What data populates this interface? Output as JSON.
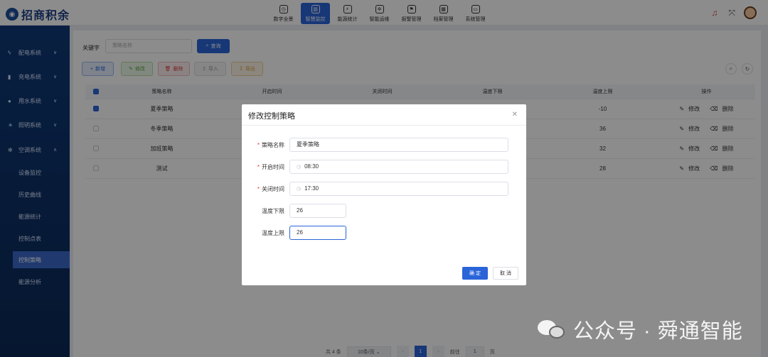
{
  "header": {
    "logo_text": "招商积余",
    "nav": [
      {
        "label": "数字全景",
        "icon": "dashboard-icon"
      },
      {
        "label": "智慧监控",
        "icon": "bar-chart-icon",
        "active": true
      },
      {
        "label": "能源统计",
        "icon": "energy-icon"
      },
      {
        "label": "智能运维",
        "icon": "gear-icon"
      },
      {
        "label": "报警管理",
        "icon": "alarm-icon"
      },
      {
        "label": "档案管理",
        "icon": "archive-icon"
      },
      {
        "label": "系统管理",
        "icon": "monitor-icon"
      }
    ]
  },
  "sidebar": {
    "groups": [
      {
        "label": "配电系统",
        "icon": "lightning-icon"
      },
      {
        "label": "充电系统",
        "icon": "charger-icon"
      },
      {
        "label": "用水系统",
        "icon": "water-drop-icon"
      },
      {
        "label": "照明系统",
        "icon": "light-icon"
      },
      {
        "label": "空调系统",
        "icon": "snowflake-icon"
      }
    ],
    "sub_items": [
      {
        "label": "设备监控"
      },
      {
        "label": "历史曲线"
      },
      {
        "label": "能源统计"
      },
      {
        "label": "控制点表"
      },
      {
        "label": "控制策略",
        "active": true
      },
      {
        "label": "能源分析"
      }
    ]
  },
  "toolbar": {
    "search_label": "关键字",
    "search_placeholder": "策略名称",
    "query_label": "查询",
    "add_label": "新增",
    "edit_label": "修改",
    "delete_label": "删除",
    "import_label": "导入",
    "export_label": "导出"
  },
  "table": {
    "headers": [
      "策略名称",
      "开启时间",
      "关闭时间",
      "温度下限",
      "温度上限",
      "操作"
    ],
    "rows": [
      {
        "name": "夏季策略",
        "start": "",
        "end": "",
        "low": "",
        "high": "-10",
        "checked": true
      },
      {
        "name": "冬季策略",
        "start": "",
        "end": "",
        "low": "",
        "high": "36",
        "checked": false
      },
      {
        "name": "加班策略",
        "start": "",
        "end": "",
        "low": "",
        "high": "32",
        "checked": false
      },
      {
        "name": "测试",
        "start": "",
        "end": "",
        "low": "",
        "high": "28",
        "checked": false
      }
    ],
    "op_edit": "修改",
    "op_delete": "删除"
  },
  "pagination": {
    "total": "共 4 条",
    "page_size": "10条/页",
    "current": "1",
    "goto_label": "前往",
    "goto_value": "1",
    "page_suffix": "页"
  },
  "dialog": {
    "title": "修改控制策略",
    "fields": {
      "name": {
        "label": "策略名称",
        "value": "夏季策略"
      },
      "start": {
        "label": "开启时间",
        "value": "08:30"
      },
      "end": {
        "label": "关闭时间",
        "value": "17:30"
      },
      "low": {
        "label": "温度下限",
        "value": "26"
      },
      "high": {
        "label": "温度上限",
        "value": "26"
      }
    },
    "ok_label": "确 定",
    "cancel_label": "取 消"
  },
  "watermark": {
    "text": "公众号 · 舜通智能"
  },
  "colors": {
    "primary": "#2a64d9",
    "sidebar": "#0f3a78",
    "danger": "#e0413e"
  }
}
